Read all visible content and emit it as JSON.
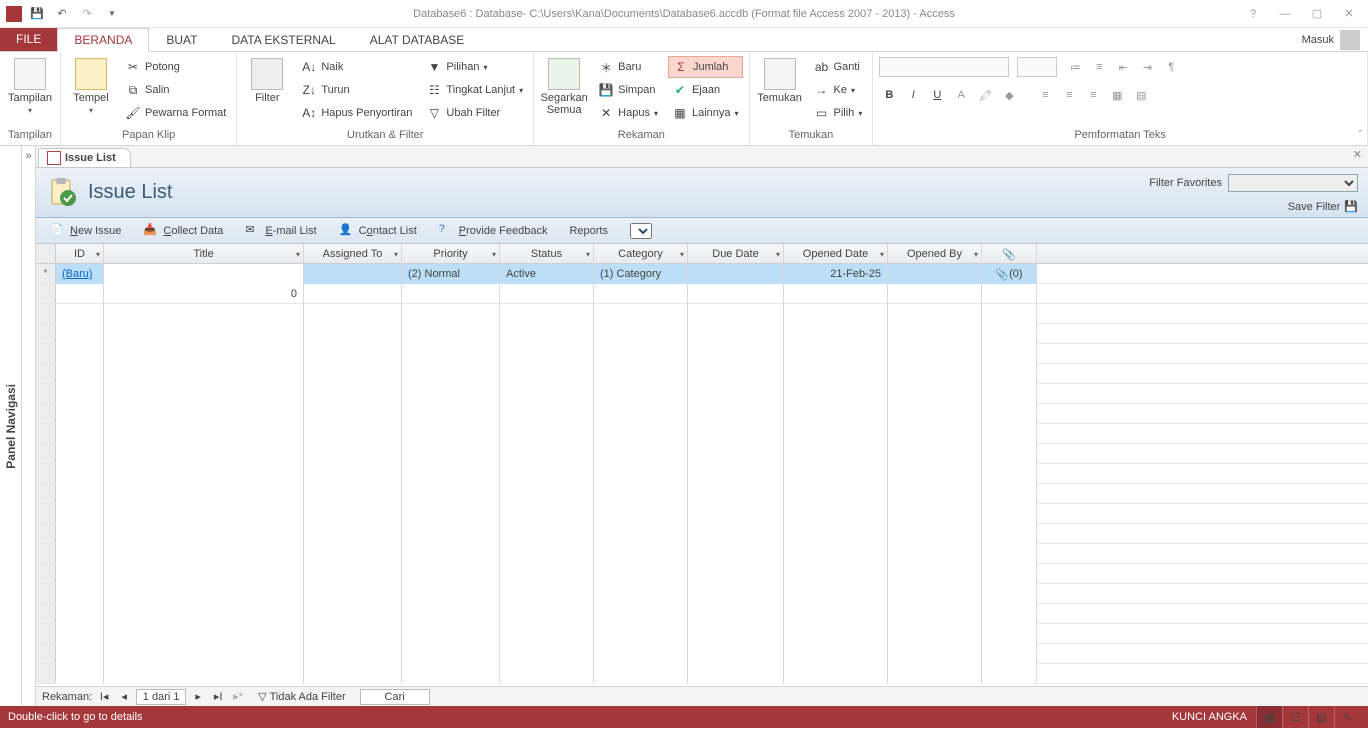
{
  "titlebar": {
    "title": "Database6 : Database- C:\\Users\\Kana\\Documents\\Database6.accdb (Format file Access 2007 - 2013) - Access"
  },
  "tabs": {
    "file": "FILE",
    "items": [
      "BERANDA",
      "BUAT",
      "DATA EKSTERNAL",
      "ALAT DATABASE"
    ],
    "active": "BERANDA",
    "signin": "Masuk"
  },
  "ribbon": {
    "groups": {
      "tampilan": {
        "label": "Tampilan",
        "btn": "Tampilan"
      },
      "clipboard": {
        "label": "Papan Klip",
        "paste": "Tempel",
        "cut": "Potong",
        "copy": "Salin",
        "painter": "Pewarna Format"
      },
      "sort": {
        "label": "Urutkan & Filter",
        "filter": "Filter",
        "asc": "Naik",
        "desc": "Turun",
        "remove": "Hapus Penyortiran",
        "selection": "Pilihan",
        "advanced": "Tingkat Lanjut",
        "toggle": "Ubah Filter"
      },
      "records": {
        "label": "Rekaman",
        "refresh": "Segarkan Semua",
        "new": "Baru",
        "save": "Simpan",
        "delete": "Hapus",
        "totals": "Jumlah",
        "spelling": "Ejaan",
        "more": "Lainnya"
      },
      "find": {
        "label": "Temukan",
        "find": "Temukan",
        "replace": "Ganti",
        "goto": "Ke",
        "select": "Pilih"
      },
      "fmt": {
        "label": "Pemformatan Teks"
      }
    }
  },
  "nav": {
    "label": "Panel Navigasi"
  },
  "docTab": {
    "title": "Issue List"
  },
  "form": {
    "title": "Issue List",
    "favLabel": "Filter Favorites",
    "saveFilter": "Save Filter"
  },
  "cmdbar": {
    "new": "New Issue",
    "collect": "Collect Data",
    "email": "E-mail List",
    "contact": "Contact List",
    "feedback": "Provide Feedback",
    "reports": "Reports"
  },
  "grid": {
    "headers": {
      "id": "ID",
      "title": "Title",
      "assigned": "Assigned To",
      "priority": "Priority",
      "status": "Status",
      "category": "Category",
      "due": "Due Date",
      "opened": "Opened Date",
      "by": "Opened By"
    },
    "rows": [
      {
        "id": "(Baru)",
        "title": "",
        "assigned": "",
        "priority": "(2) Normal",
        "status": "Active",
        "category": "(1) Category",
        "due": "",
        "opened": "21-Feb-25",
        "by": "",
        "att": "(0)"
      },
      {
        "id": "",
        "title": "0",
        "assigned": "",
        "priority": "",
        "status": "",
        "category": "",
        "due": "",
        "opened": "",
        "by": "",
        "att": ""
      }
    ]
  },
  "recnav": {
    "label": "Rekaman:",
    "pos": "1 dari 1",
    "nofilter": "Tidak Ada Filter",
    "search": "Cari"
  },
  "status": {
    "hint": "Double-click to go to details",
    "numlock": "KUNCI ANGKA"
  }
}
